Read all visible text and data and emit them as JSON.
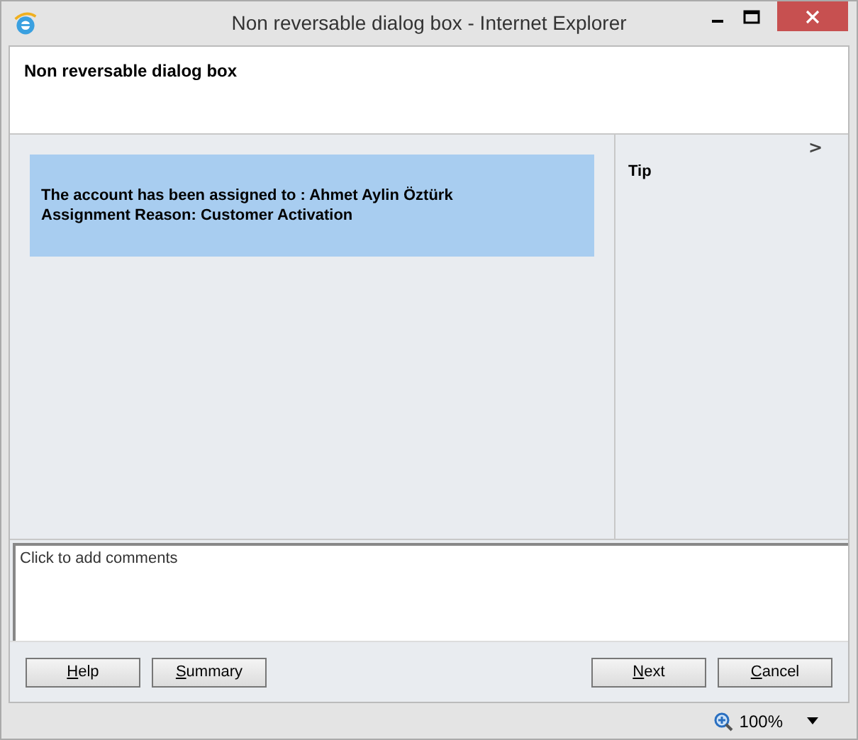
{
  "window": {
    "title": "Non reversable dialog box - Internet Explorer"
  },
  "header": {
    "title": "Non reversable dialog box"
  },
  "message": {
    "lines": [
      "The account has been assigned to : Ahmet Aylin Öztürk",
      "Assignment Reason: Customer Activation"
    ]
  },
  "tip_panel": {
    "title": "Tip",
    "expand_glyph": ">"
  },
  "comments": {
    "placeholder": "Click to add comments"
  },
  "buttons_left": [
    {
      "key": "H",
      "rest": "elp"
    },
    {
      "key": "S",
      "rest": "ummary"
    }
  ],
  "buttons_right": [
    {
      "key": "N",
      "rest": "ext"
    },
    {
      "key": "C",
      "rest": "ancel"
    }
  ],
  "status_bar": {
    "zoom": "100%"
  }
}
